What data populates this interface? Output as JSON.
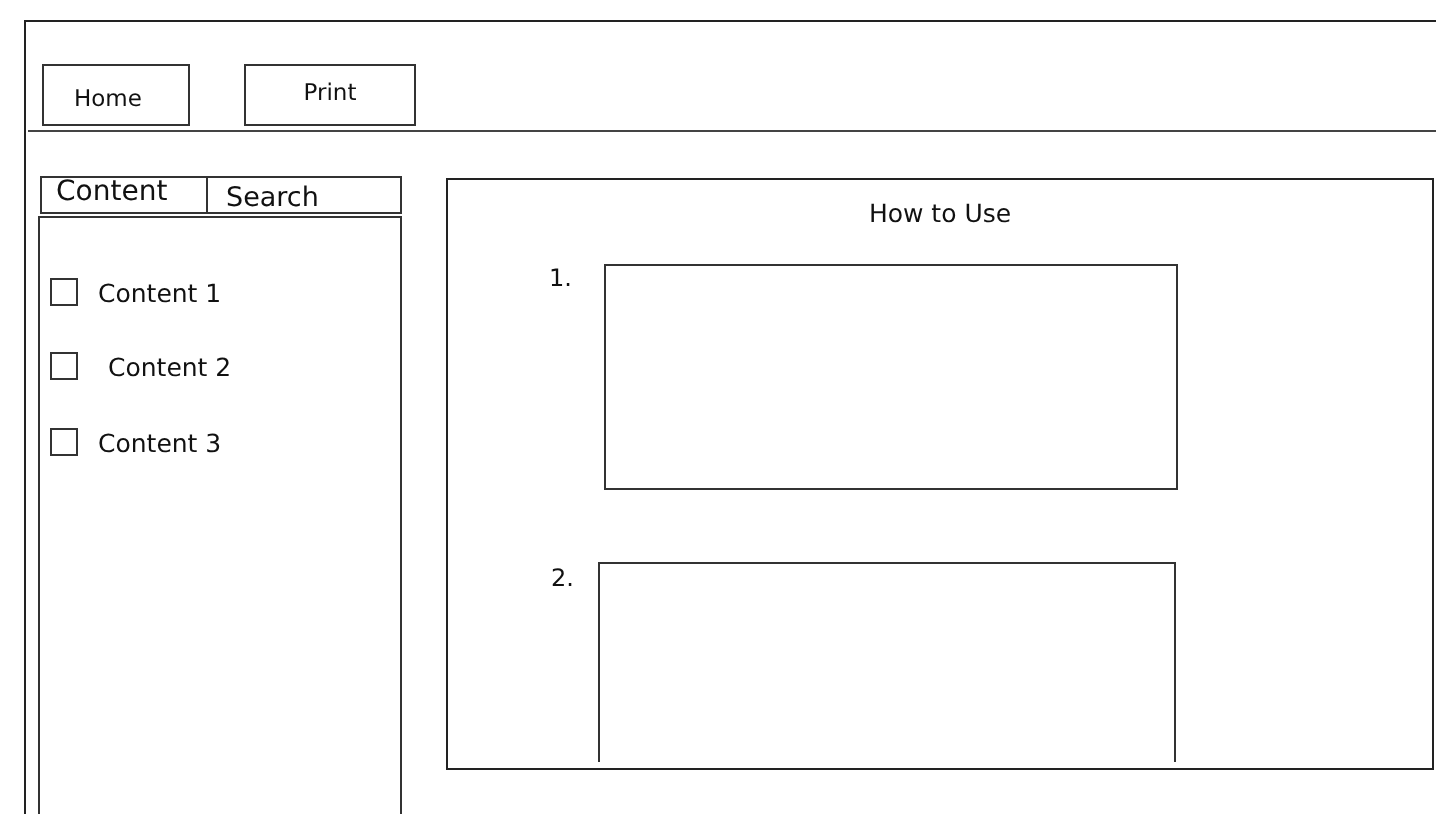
{
  "toolbar": {
    "buttons": [
      {
        "label": "Home"
      },
      {
        "label": "Print"
      }
    ]
  },
  "sidebar": {
    "tabs": [
      {
        "label": "Content"
      },
      {
        "label": "Search"
      }
    ],
    "items": [
      {
        "label": "Content 1",
        "checked": false
      },
      {
        "label": "Content 2",
        "checked": false
      },
      {
        "label": "Content 3",
        "checked": false
      }
    ]
  },
  "main": {
    "title": "How to Use",
    "steps": [
      {
        "number": "1."
      },
      {
        "number": "2."
      }
    ]
  }
}
